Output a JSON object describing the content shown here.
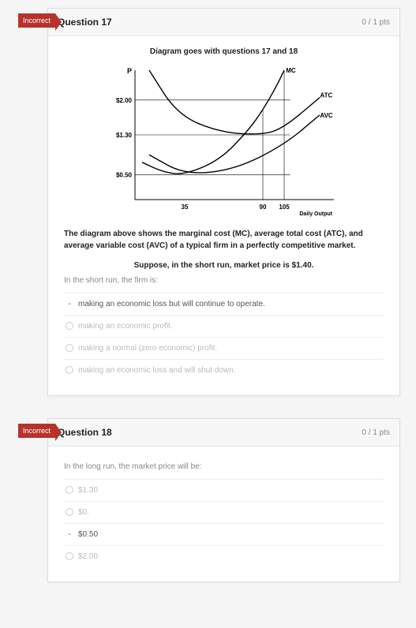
{
  "questions": [
    {
      "flag": "Incorrect",
      "title": "Question 17",
      "points": "0 / 1 pts",
      "diagram_caption": "Diagram goes with questions 17 and 18",
      "prompt_main": "The diagram above shows the marginal cost (MC), average total cost (ATC), and average variable cost (AVC) of a typical firm in a perfectly competitive market.",
      "prompt_sub": "Suppose, in the short run, market price is $1.40.",
      "stem": "In the short run, the firm is:",
      "options": [
        {
          "text": "making an economic loss but will continue to operate.",
          "selected": true
        },
        {
          "text": "making an economic profit.",
          "selected": false
        },
        {
          "text": "making a normal (zero economic) profit.",
          "selected": false
        },
        {
          "text": "making an economic loss and will shut down.",
          "selected": false
        }
      ]
    },
    {
      "flag": "Incorrect",
      "title": "Question 18",
      "points": "0 / 1 pts",
      "stem": "In the long run, the market price will be:",
      "options": [
        {
          "text": "$1.30",
          "selected": false
        },
        {
          "text": "$0.",
          "selected": false
        },
        {
          "text": "$0.50",
          "selected": true
        },
        {
          "text": "$2.00",
          "selected": false
        }
      ]
    }
  ],
  "chart_data": {
    "type": "line",
    "title": "",
    "xlabel": "Daily Output",
    "ylabel": "P",
    "x_ticks": [
      35,
      90,
      105
    ],
    "y_ticks": [
      "$0.50",
      "$1.30",
      "$2.00"
    ],
    "xlim": [
      0,
      140
    ],
    "ylim": [
      0,
      2.6
    ],
    "series": [
      {
        "name": "MC",
        "x": [
          5,
          20,
          35,
          60,
          80,
          90,
          100,
          105
        ],
        "y": [
          0.75,
          0.55,
          0.5,
          0.8,
          1.4,
          1.8,
          2.3,
          2.6
        ]
      },
      {
        "name": "ATC",
        "x": [
          10,
          30,
          60,
          90,
          105,
          130
        ],
        "y": [
          2.6,
          1.7,
          1.35,
          1.3,
          1.45,
          2.05
        ]
      },
      {
        "name": "AVC",
        "x": [
          10,
          35,
          70,
          105,
          130
        ],
        "y": [
          0.9,
          0.5,
          0.6,
          1.1,
          1.7
        ]
      }
    ],
    "guides": [
      {
        "type": "hline",
        "y": 2.0
      },
      {
        "type": "hline",
        "y": 1.3
      },
      {
        "type": "hline",
        "y": 0.5
      },
      {
        "type": "vline",
        "x": 90,
        "y_to": 1.8
      },
      {
        "type": "vline",
        "x": 105,
        "y_to": 2.6
      }
    ]
  }
}
